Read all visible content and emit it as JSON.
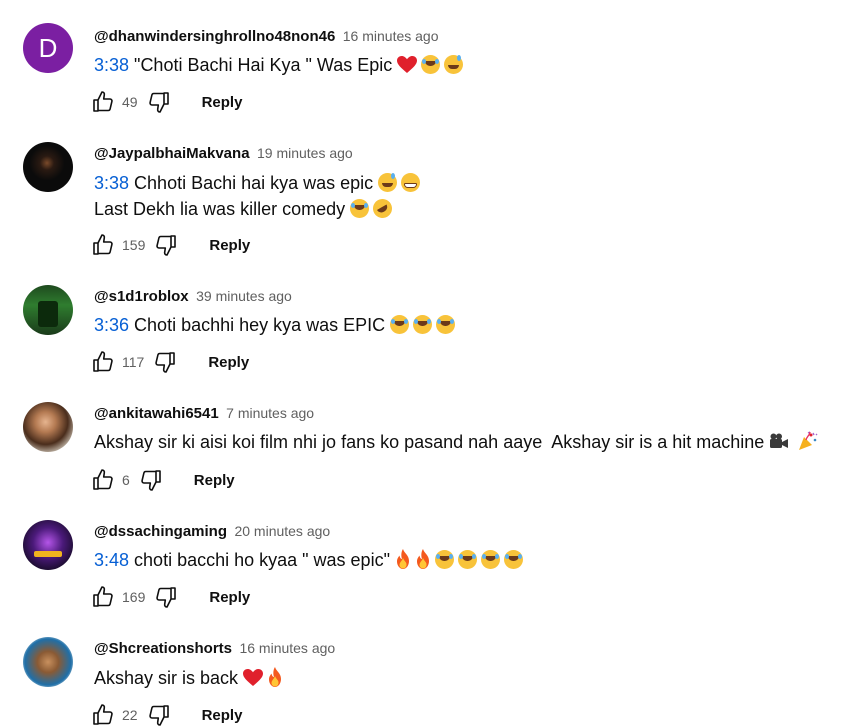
{
  "comments": [
    {
      "avatar": {
        "letter": "D",
        "color": "#7b1fa2"
      },
      "handle": "@dhanwindersinghrollno48non46",
      "time": "16 minutes ago",
      "lines": [
        {
          "timestamp": "3:38",
          "text": " \"Choti Bachi Hai Kya \" Was Epic "
        }
      ],
      "likes": "49",
      "reply_label": "Reply"
    },
    {
      "handle": "@JaypalbhaiMakvana",
      "time": "19 minutes ago",
      "lines": [
        {
          "timestamp": "3:38",
          "text": " Chhoti Bachi hai kya was epic "
        },
        {
          "text": "Last Dekh lia was killer comedy "
        }
      ],
      "likes": "159",
      "reply_label": "Reply"
    },
    {
      "handle": "@s1d1roblox",
      "time": "39 minutes ago",
      "lines": [
        {
          "timestamp": "3:36",
          "text": " Choti bachhi hey kya was EPIC "
        }
      ],
      "likes": "117",
      "reply_label": "Reply"
    },
    {
      "handle": "@ankitawahi6541",
      "time": "7 minutes ago",
      "lines": [
        {
          "text": "Akshay sir ki aisi koi film nhi jo fans ko pasand nah aaye  Akshay sir is a hit machine "
        }
      ],
      "likes": "6",
      "reply_label": "Reply"
    },
    {
      "handle": "@dssachingaming",
      "time": "20 minutes ago",
      "lines": [
        {
          "timestamp": "3:48",
          "text": " choti bacchi ho kyaa \" was epic\" "
        }
      ],
      "likes": "169",
      "reply_label": "Reply"
    },
    {
      "handle": "@Shcreationshorts",
      "time": "16 minutes ago",
      "lines": [
        {
          "text": "Akshay sir is back "
        }
      ],
      "likes": "22",
      "reply_label": "Reply"
    }
  ],
  "colors": {
    "timestamp_link": "#065fd4",
    "secondary_text": "#606060",
    "primary_text": "#0f0f0f"
  },
  "icons": [
    "thumb-up-icon",
    "thumb-down-icon",
    "heart-emoji",
    "joy-emoji",
    "sweat-smile-emoji",
    "grin-emoji",
    "rofl-emoji",
    "fire-emoji",
    "movie-camera-emoji",
    "party-popper-emoji"
  ]
}
